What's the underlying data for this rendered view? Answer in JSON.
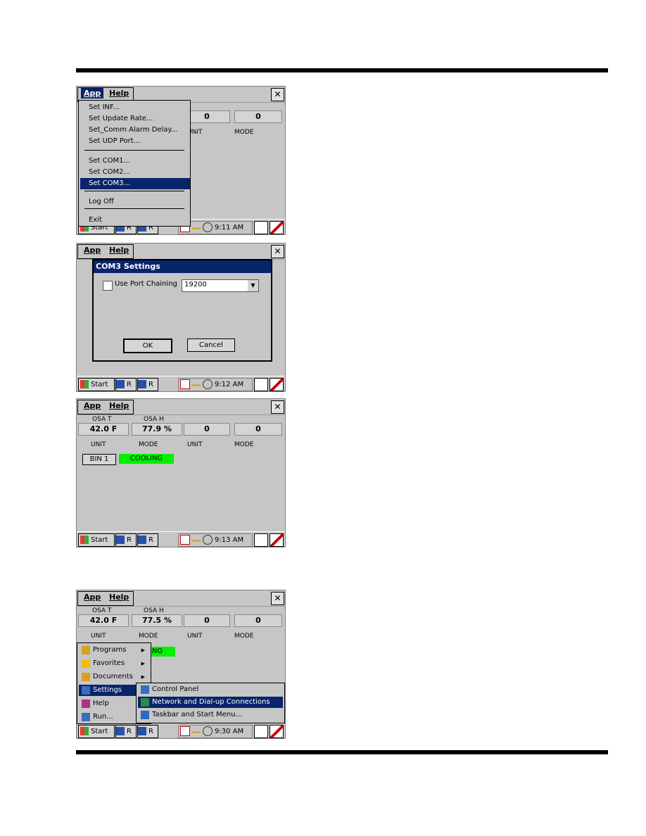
{
  "screens": [
    {
      "menubar": {
        "app": "App",
        "help": "Help",
        "close": "✕"
      },
      "values": [
        "0",
        "0"
      ],
      "labels": [
        "UNIT",
        "MODE"
      ],
      "app_menu": {
        "items": [
          "Set INF...",
          "Set Update Rate...",
          "Set_Comm Alarm Delay...",
          "Set UDP Port...",
          "Set COM1...",
          "Set COM2...",
          "Set COM3...",
          "Log Off",
          "Exit"
        ],
        "selected": "Set COM3..."
      },
      "taskbar": {
        "start": "Start",
        "task1": "R",
        "task2": "R",
        "time": "9:11 AM"
      }
    },
    {
      "menubar": {
        "app": "App",
        "help": "Help",
        "close": "✕"
      },
      "dialog": {
        "title": "COM3 Settings",
        "checkbox_label": "Use Port Chaining",
        "checked": false,
        "baud": "19200",
        "ok": "OK",
        "cancel": "Cancel"
      },
      "taskbar": {
        "start": "Start",
        "task1": "R",
        "task2": "R",
        "time": "9:12 AM"
      }
    },
    {
      "menubar": {
        "app": "App",
        "help": "Help",
        "close": "✕"
      },
      "top_labels": [
        "OSA T",
        "OSA H"
      ],
      "values": [
        "42.0 F",
        "77.9 %",
        "0",
        "0"
      ],
      "labels": [
        "UNIT",
        "MODE",
        "UNIT",
        "MODE"
      ],
      "bin_button": "BIN 1",
      "status": "COOLING",
      "status_color": "#00f000",
      "taskbar": {
        "start": "Start",
        "task1": "R",
        "task2": "R",
        "time": "9:13 AM"
      }
    },
    {
      "menubar": {
        "app": "App",
        "help": "Help",
        "close": "✕"
      },
      "top_labels": [
        "OSA T",
        "OSA H"
      ],
      "values": [
        "42.0 F",
        "77.5 %",
        "0",
        "0"
      ],
      "labels": [
        "UNIT",
        "MODE",
        "UNIT",
        "MODE"
      ],
      "status_partial": "ING",
      "start_menu": {
        "items": [
          "Programs",
          "Favorites",
          "Documents",
          "Settings",
          "Help",
          "Run..."
        ],
        "selected": "Settings"
      },
      "settings_submenu": {
        "items": [
          "Control Panel",
          "Network and Dial-up Connections",
          "Taskbar and Start Menu..."
        ],
        "selected": "Network and Dial-up Connections"
      },
      "taskbar": {
        "start": "Start",
        "task1": "R",
        "task2": "R",
        "time": "9:30 AM"
      }
    }
  ]
}
